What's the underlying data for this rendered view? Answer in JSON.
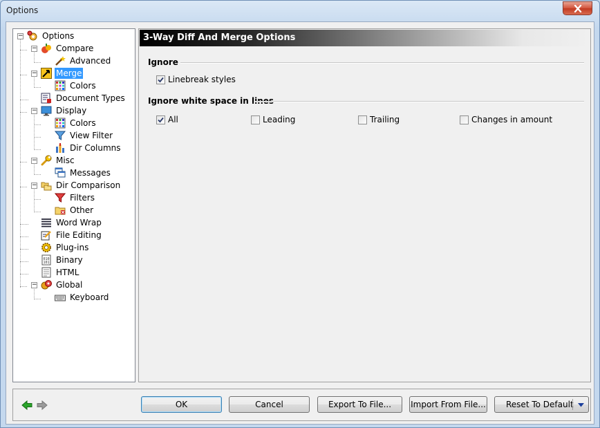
{
  "window": {
    "title": "Options"
  },
  "tree": {
    "items": [
      {
        "label": "Options",
        "icon": "options-gear-icon"
      },
      {
        "label": "Compare",
        "icon": "compare-icon"
      },
      {
        "label": "Advanced",
        "icon": "advanced-wand-icon"
      },
      {
        "label": "Merge",
        "icon": "merge-icon",
        "selected": true
      },
      {
        "label": "Colors",
        "icon": "colors-grid-icon"
      },
      {
        "label": "Document Types",
        "icon": "document-types-icon"
      },
      {
        "label": "Display",
        "icon": "display-monitor-icon"
      },
      {
        "label": "Colors",
        "icon": "colors-grid-icon"
      },
      {
        "label": "View Filter",
        "icon": "filter-funnel-icon"
      },
      {
        "label": "Dir Columns",
        "icon": "dir-columns-icon"
      },
      {
        "label": "Misc",
        "icon": "wrench-icon"
      },
      {
        "label": "Messages",
        "icon": "messages-icon"
      },
      {
        "label": "Dir Comparison",
        "icon": "folders-icon"
      },
      {
        "label": "Filters",
        "icon": "filter-funnel-icon"
      },
      {
        "label": "Other",
        "icon": "folder-other-icon"
      },
      {
        "label": "Word Wrap",
        "icon": "word-wrap-icon"
      },
      {
        "label": "File Editing",
        "icon": "file-editing-icon"
      },
      {
        "label": "Plug-ins",
        "icon": "plugins-gear-icon"
      },
      {
        "label": "Binary",
        "icon": "binary-file-icon"
      },
      {
        "label": "HTML",
        "icon": "html-file-icon"
      },
      {
        "label": "Global",
        "icon": "global-icon"
      },
      {
        "label": "Keyboard",
        "icon": "keyboard-icon"
      }
    ]
  },
  "panel": {
    "header": "3-Way Diff And Merge Options",
    "ignore": {
      "label": "Ignore",
      "linebreak_styles": {
        "label": "Linebreak styles",
        "checked": true
      }
    },
    "whitespace": {
      "label": "Ignore white space in lines",
      "options": [
        {
          "label": "All",
          "checked": true
        },
        {
          "label": "Leading",
          "checked": false
        },
        {
          "label": "Trailing",
          "checked": false
        },
        {
          "label": "Changes in amount",
          "checked": false
        }
      ]
    }
  },
  "footer": {
    "ok": "OK",
    "cancel": "Cancel",
    "export": "Export To File...",
    "import": "Import From File...",
    "reset": "Reset To Default"
  },
  "colors": {
    "selection": "#3399ff",
    "back_arrow": "#2aa52a",
    "forward_arrow": "#9a9a9a"
  }
}
